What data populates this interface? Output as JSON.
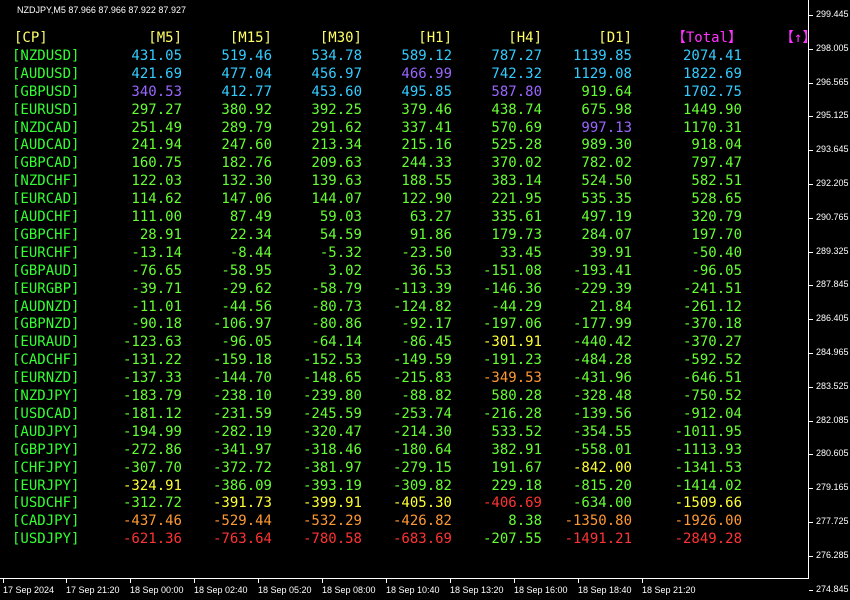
{
  "window": {
    "title": "NZDJPY,M5  87.966 87.966 87.922 87.927"
  },
  "headers": [
    {
      "label": "[CP]",
      "color": "#ffff66"
    },
    {
      "label": "[M5]",
      "color": "#ffff66"
    },
    {
      "label": "[M15]",
      "color": "#ffff66"
    },
    {
      "label": "[M30]",
      "color": "#ffff66"
    },
    {
      "label": "[H1]",
      "color": "#ffff66"
    },
    {
      "label": "[H4]",
      "color": "#ffff66"
    },
    {
      "label": "[D1]",
      "color": "#ffff66"
    },
    {
      "label": "【Total】",
      "color": "#ff33ff"
    },
    {
      "label": "【↑】",
      "color": "#ff33ff"
    }
  ],
  "rows": [
    {
      "pair": "[NZDUSD]",
      "m5": "431.05",
      "m15": "519.46",
      "m30": "534.78",
      "h1": "589.12",
      "h4": "787.27",
      "d1": "1139.85",
      "total": "2074.41"
    },
    {
      "pair": "[AUDUSD]",
      "m5": "421.69",
      "m15": "477.04",
      "m30": "456.97",
      "h1": "466.99",
      "h4": "742.32",
      "d1": "1129.08",
      "total": "1822.69"
    },
    {
      "pair": "[GBPUSD]",
      "m5": "340.53",
      "m15": "412.77",
      "m30": "453.60",
      "h1": "495.85",
      "h4": "587.80",
      "d1": "919.64",
      "total": "1702.75"
    },
    {
      "pair": "[EURUSD]",
      "m5": "297.27",
      "m15": "380.92",
      "m30": "392.25",
      "h1": "379.46",
      "h4": "438.74",
      "d1": "675.98",
      "total": "1449.90"
    },
    {
      "pair": "[NZDCAD]",
      "m5": "251.49",
      "m15": "289.79",
      "m30": "291.62",
      "h1": "337.41",
      "h4": "570.69",
      "d1": "997.13",
      "total": "1170.31"
    },
    {
      "pair": "[AUDCAD]",
      "m5": "241.94",
      "m15": "247.60",
      "m30": "213.34",
      "h1": "215.16",
      "h4": "525.28",
      "d1": "989.30",
      "total": "918.04"
    },
    {
      "pair": "[GBPCAD]",
      "m5": "160.75",
      "m15": "182.76",
      "m30": "209.63",
      "h1": "244.33",
      "h4": "370.02",
      "d1": "782.02",
      "total": "797.47"
    },
    {
      "pair": "[NZDCHF]",
      "m5": "122.03",
      "m15": "132.30",
      "m30": "139.63",
      "h1": "188.55",
      "h4": "383.14",
      "d1": "524.50",
      "total": "582.51"
    },
    {
      "pair": "[EURCAD]",
      "m5": "114.62",
      "m15": "147.06",
      "m30": "144.07",
      "h1": "122.90",
      "h4": "221.95",
      "d1": "535.35",
      "total": "528.65"
    },
    {
      "pair": "[AUDCHF]",
      "m5": "111.00",
      "m15": "87.49",
      "m30": "59.03",
      "h1": "63.27",
      "h4": "335.61",
      "d1": "497.19",
      "total": "320.79"
    },
    {
      "pair": "[GBPCHF]",
      "m5": "28.91",
      "m15": "22.34",
      "m30": "54.59",
      "h1": "91.86",
      "h4": "179.73",
      "d1": "284.07",
      "total": "197.70"
    },
    {
      "pair": "[EURCHF]",
      "m5": "-13.14",
      "m15": "-8.44",
      "m30": "-5.32",
      "h1": "-23.50",
      "h4": "33.45",
      "d1": "39.91",
      "total": "-50.40"
    },
    {
      "pair": "[GBPAUD]",
      "m5": "-76.65",
      "m15": "-58.95",
      "m30": "3.02",
      "h1": "36.53",
      "h4": "-151.08",
      "d1": "-193.41",
      "total": "-96.05"
    },
    {
      "pair": "[EURGBP]",
      "m5": "-39.71",
      "m15": "-29.62",
      "m30": "-58.79",
      "h1": "-113.39",
      "h4": "-146.36",
      "d1": "-229.39",
      "total": "-241.51"
    },
    {
      "pair": "[AUDNZD]",
      "m5": "-11.01",
      "m15": "-44.56",
      "m30": "-80.73",
      "h1": "-124.82",
      "h4": "-44.29",
      "d1": "21.84",
      "total": "-261.12"
    },
    {
      "pair": "[GBPNZD]",
      "m5": "-90.18",
      "m15": "-106.97",
      "m30": "-80.86",
      "h1": "-92.17",
      "h4": "-197.06",
      "d1": "-177.99",
      "total": "-370.18"
    },
    {
      "pair": "[EURAUD]",
      "m5": "-123.63",
      "m15": "-96.05",
      "m30": "-64.14",
      "h1": "-86.45",
      "h4": "-301.91",
      "d1": "-440.42",
      "total": "-370.27"
    },
    {
      "pair": "[CADCHF]",
      "m5": "-131.22",
      "m15": "-159.18",
      "m30": "-152.53",
      "h1": "-149.59",
      "h4": "-191.23",
      "d1": "-484.28",
      "total": "-592.52"
    },
    {
      "pair": "[EURNZD]",
      "m5": "-137.33",
      "m15": "-144.70",
      "m30": "-148.65",
      "h1": "-215.83",
      "h4": "-349.53",
      "d1": "-431.96",
      "total": "-646.51"
    },
    {
      "pair": "[NZDJPY]",
      "m5": "-183.79",
      "m15": "-238.10",
      "m30": "-239.80",
      "h1": "-88.82",
      "h4": "580.28",
      "d1": "-328.48",
      "total": "-750.52"
    },
    {
      "pair": "[USDCAD]",
      "m5": "-181.12",
      "m15": "-231.59",
      "m30": "-245.59",
      "h1": "-253.74",
      "h4": "-216.28",
      "d1": "-139.56",
      "total": "-912.04"
    },
    {
      "pair": "[AUDJPY]",
      "m5": "-194.99",
      "m15": "-282.19",
      "m30": "-320.47",
      "h1": "-214.30",
      "h4": "533.52",
      "d1": "-354.55",
      "total": "-1011.95"
    },
    {
      "pair": "[GBPJPY]",
      "m5": "-272.86",
      "m15": "-341.97",
      "m30": "-318.46",
      "h1": "-180.64",
      "h4": "382.91",
      "d1": "-558.01",
      "total": "-1113.93"
    },
    {
      "pair": "[CHFJPY]",
      "m5": "-307.70",
      "m15": "-372.72",
      "m30": "-381.97",
      "h1": "-279.15",
      "h4": "191.67",
      "d1": "-842.00",
      "total": "-1341.53"
    },
    {
      "pair": "[EURJPY]",
      "m5": "-324.91",
      "m15": "-386.09",
      "m30": "-393.19",
      "h1": "-309.82",
      "h4": "229.18",
      "d1": "-815.20",
      "total": "-1414.02"
    },
    {
      "pair": "[USDCHF]",
      "m5": "-312.72",
      "m15": "-391.73",
      "m30": "-399.91",
      "h1": "-405.30",
      "h4": "-406.69",
      "d1": "-634.00",
      "total": "-1509.66"
    },
    {
      "pair": "[CADJPY]",
      "m5": "-437.46",
      "m15": "-529.44",
      "m30": "-532.29",
      "h1": "-426.82",
      "h4": "8.38",
      "d1": "-1350.80",
      "total": "-1926.00"
    },
    {
      "pair": "[USDJPY]",
      "m5": "-621.36",
      "m15": "-763.64",
      "m30": "-780.58",
      "h1": "-683.69",
      "h4": "-207.55",
      "d1": "-1491.21",
      "total": "-2849.28"
    }
  ],
  "color_scale": {
    "strong_pos": "#33ccff",
    "pos_mid": "#6699ff",
    "violet": "#9966ff",
    "green": "#66ff33",
    "yellow": "#ffff33",
    "orange": "#ff9933",
    "red": "#ff3333",
    "pair": "#33ff33"
  },
  "price_axis": [
    "299.445",
    "298.005",
    "296.565",
    "295.125",
    "293.645",
    "292.205",
    "290.765",
    "289.325",
    "287.845",
    "286.405",
    "284.965",
    "283.525",
    "282.085",
    "280.605",
    "279.165",
    "277.725",
    "276.285",
    "274.845"
  ],
  "time_axis": [
    "17 Sep 2024",
    "17 Sep 21:20",
    "18 Sep 00:00",
    "18 Sep 02:40",
    "18 Sep 05:20",
    "18 Sep 08:00",
    "18 Sep 10:40",
    "18 Sep 13:20",
    "18 Sep 16:00",
    "18 Sep 18:40",
    "18 Sep 21:20"
  ]
}
